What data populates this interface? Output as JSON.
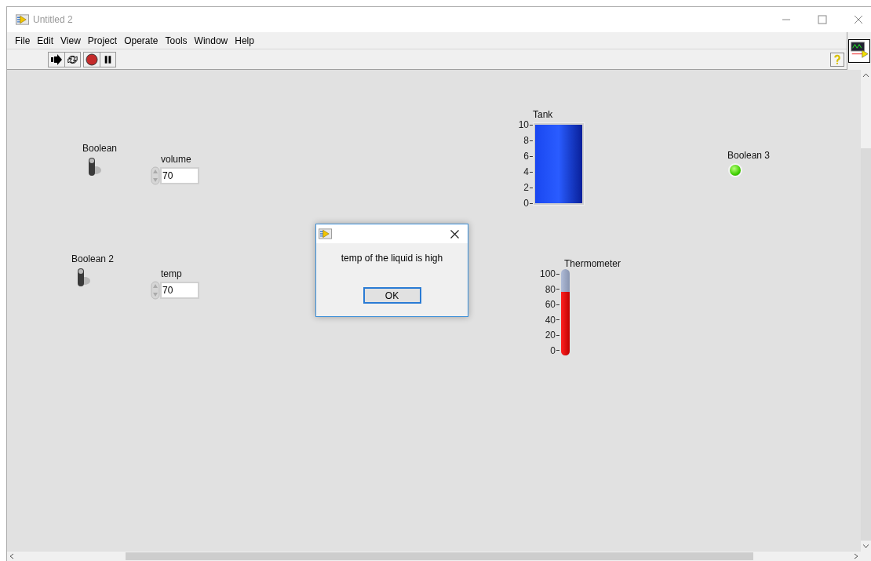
{
  "window": {
    "title": "Untitled 2"
  },
  "menu": [
    "File",
    "Edit",
    "View",
    "Project",
    "Operate",
    "Tools",
    "Window",
    "Help"
  ],
  "panel": {
    "controls": [
      {
        "kind": "toggle",
        "label": "Boolean",
        "on": false
      },
      {
        "kind": "numeric",
        "label": "volume",
        "value": "70"
      },
      {
        "kind": "toggle",
        "label": "Boolean 2",
        "on": false
      },
      {
        "kind": "numeric",
        "label": "temp",
        "value": "70"
      },
      {
        "kind": "tank",
        "label": "Tank",
        "scale": [
          "10",
          "8",
          "6",
          "4",
          "2",
          "0"
        ],
        "level": 1
      },
      {
        "kind": "led",
        "label": "Boolean 3",
        "on": true
      },
      {
        "kind": "thermometer",
        "label": "Thermometer",
        "scale": [
          "100",
          "80",
          "60",
          "40",
          "20",
          "0"
        ],
        "level": 0.7
      }
    ]
  },
  "dialog": {
    "message": "temp of the liquid is high",
    "button": "OK"
  }
}
